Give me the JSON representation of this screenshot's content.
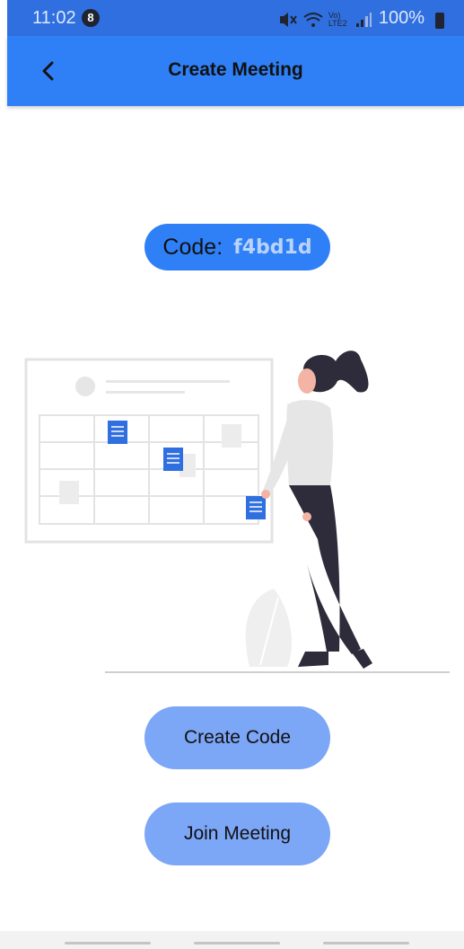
{
  "status_bar": {
    "time": "11:02",
    "notification_count": "8",
    "battery": "100%",
    "network": "Vo) LTE2"
  },
  "app_bar": {
    "title": "Create Meeting",
    "back_icon": "chevron-left-icon"
  },
  "code": {
    "label": "Code:",
    "value": "f4bd1d"
  },
  "buttons": {
    "create_code": "Create Code",
    "join_meeting": "Join Meeting"
  },
  "colors": {
    "primary": "#2f80f7",
    "button": "#7ca6f6",
    "code_text": "#b9d3fb"
  }
}
